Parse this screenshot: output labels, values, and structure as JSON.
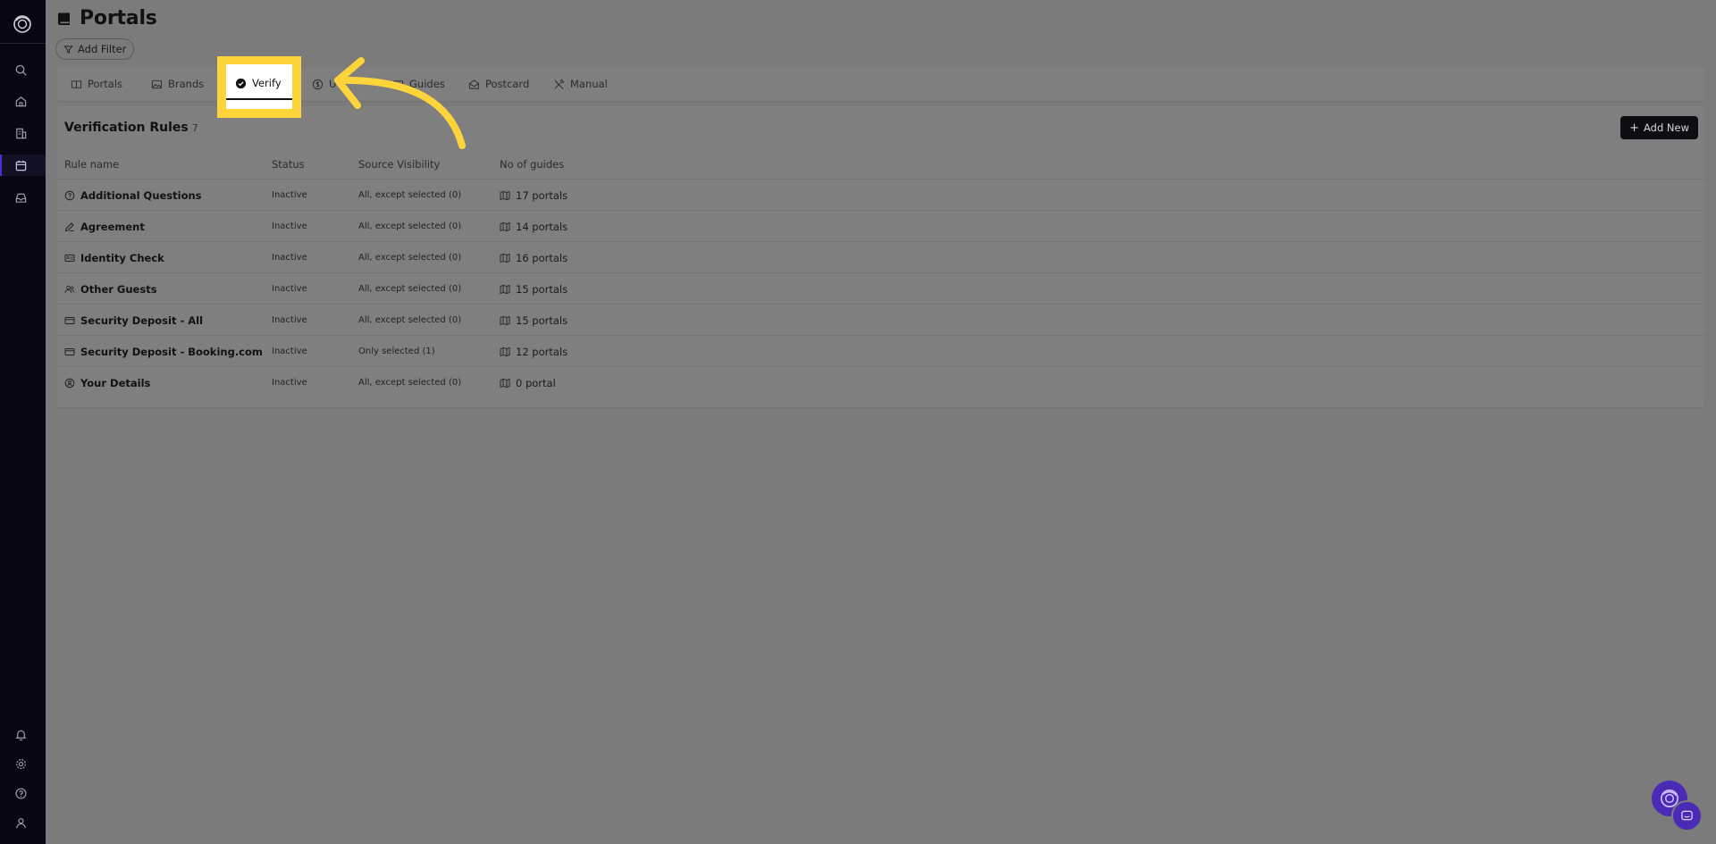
{
  "app": {
    "page_title": "Portals",
    "add_filter_label": "Add Filter"
  },
  "sidebar": {
    "top_icons": [
      "search-icon",
      "home-icon",
      "building-icon",
      "calendar-icon",
      "inbox-icon"
    ],
    "bottom_icons": [
      "bell-icon",
      "gear-icon",
      "help-icon",
      "user-icon"
    ],
    "active_item": "calendar-icon"
  },
  "tabs": [
    {
      "label": "Portals",
      "icon": "book-icon"
    },
    {
      "label": "Brands",
      "icon": "image-icon"
    },
    {
      "label": "Verify",
      "icon": "check-circle-icon",
      "active": true
    },
    {
      "label": "U",
      "icon": "coin-icon"
    },
    {
      "label": "Guides",
      "icon": "guide-icon"
    },
    {
      "label": "Postcard",
      "icon": "envelope-open-icon"
    },
    {
      "label": "Manual",
      "icon": "tools-icon"
    }
  ],
  "card": {
    "title": "Verification Rules",
    "count": "7",
    "add_new_label": "Add New",
    "columns": [
      "Rule name",
      "Status",
      "Source Visibility",
      "No of guides"
    ],
    "rows": [
      {
        "name": "Additional Questions",
        "icon": "question-circle-icon",
        "status": "Inactive",
        "source": "All, except selected (0)",
        "guides": "17 portals"
      },
      {
        "name": "Agreement",
        "icon": "edit-icon",
        "status": "Inactive",
        "source": "All, except selected (0)",
        "guides": "14 portals"
      },
      {
        "name": "Identity Check",
        "icon": "id-card-icon",
        "status": "Inactive",
        "source": "All, except selected (0)",
        "guides": "16 portals"
      },
      {
        "name": "Other Guests",
        "icon": "users-icon",
        "status": "Inactive",
        "source": "All, except selected (0)",
        "guides": "15 portals"
      },
      {
        "name": "Security Deposit - All",
        "icon": "credit-card-icon",
        "status": "Inactive",
        "source": "All, except selected (0)",
        "guides": "15 portals"
      },
      {
        "name": "Security Deposit - Booking.com",
        "icon": "credit-card-icon",
        "status": "Inactive",
        "source": "Only selected (1)",
        "guides": "12 portals"
      },
      {
        "name": "Your Details",
        "icon": "user-circle-icon",
        "status": "Inactive",
        "source": "All, except selected (0)",
        "guides": "0 portal"
      }
    ]
  },
  "colors": {
    "sidebar_bg": "#070612",
    "overlay_bg": "#7b7b7b",
    "highlight": "#fed43b",
    "accent": "#4a2bb5",
    "primary_button": "#0d0d12"
  }
}
